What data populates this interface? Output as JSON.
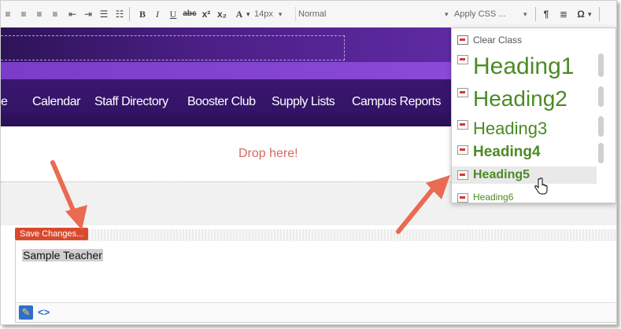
{
  "toolbar": {
    "font_size": "14px",
    "format": "Normal",
    "apply_css": "Apply CSS ...",
    "icons": [
      "align-left-icon",
      "align-center-icon",
      "align-right-icon",
      "align-justify-icon",
      "outdent-icon",
      "indent-icon",
      "bullet-list-icon",
      "numbered-list-icon",
      "bold-icon",
      "italic-icon",
      "underline-icon",
      "strikethrough-icon",
      "superscript-icon",
      "subscript-icon",
      "font-color-icon",
      "paragraph-icon",
      "align-icon",
      "omega-icon"
    ],
    "glyphs": {
      "bold": "B",
      "italic": "I",
      "underline": "U",
      "strike": "abc",
      "sup": "x²",
      "sub": "x₂",
      "color": "A",
      "para": "¶",
      "omega": "Ω"
    }
  },
  "nav": {
    "items": [
      "e",
      "Calendar",
      "Staff Directory",
      "Booster Club",
      "Supply Lists",
      "Campus Reports"
    ]
  },
  "drop_zone": {
    "text": "Drop here!"
  },
  "editor": {
    "save_label": "Save Changes...",
    "content": "Sample Teacher"
  },
  "css_dropdown": {
    "clear": "Clear Class",
    "items": [
      "Heading1",
      "Heading2",
      "Heading3",
      "Heading4",
      "Heading5",
      "Heading6"
    ],
    "hovered_index": 4,
    "label_color": "#4b8a25"
  },
  "colors": {
    "arrow": "#ea6a52",
    "save_tab": "#d84a2f",
    "nav_bg": "#341468"
  }
}
